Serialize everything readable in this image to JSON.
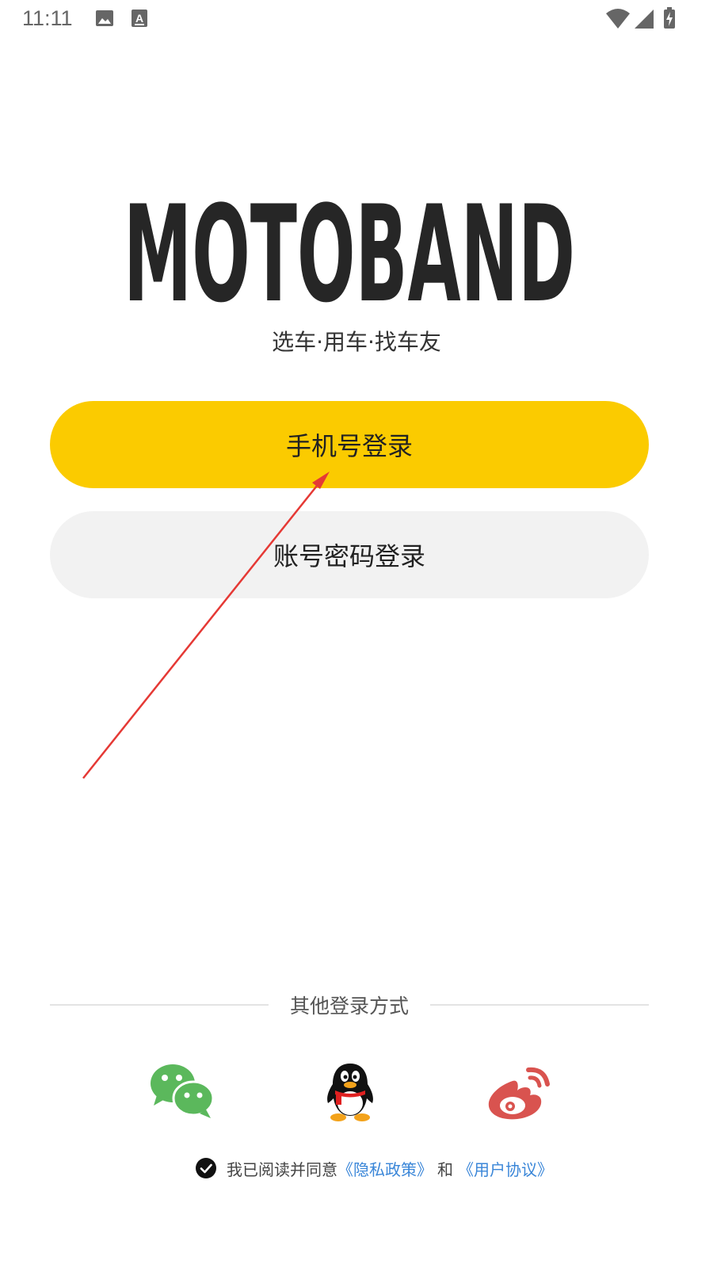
{
  "status_bar": {
    "time": "11:11",
    "icons": [
      "image-icon",
      "keyboard-a-icon",
      "wifi-icon",
      "signal-icon",
      "battery-charging-icon"
    ]
  },
  "logo": {
    "text": "MOTOBAND"
  },
  "tagline": "选车·用车·找车友",
  "buttons": {
    "phone_login": "手机号登录",
    "password_login": "账号密码登录"
  },
  "other_login": {
    "label": "其他登录方式",
    "methods": [
      "wechat-icon",
      "qq-icon",
      "weibo-icon"
    ]
  },
  "agreement": {
    "prefix": "我已阅读并同意",
    "privacy": "《隐私政策》",
    "and": "和",
    "terms": "《用户协议》"
  },
  "colors": {
    "primary_button": "#FBCB00",
    "secondary_button": "#F2F2F2",
    "link": "#3A86D8",
    "wechat": "#5BB85C",
    "weibo": "#D9534F",
    "annotation_arrow": "#E53935"
  }
}
